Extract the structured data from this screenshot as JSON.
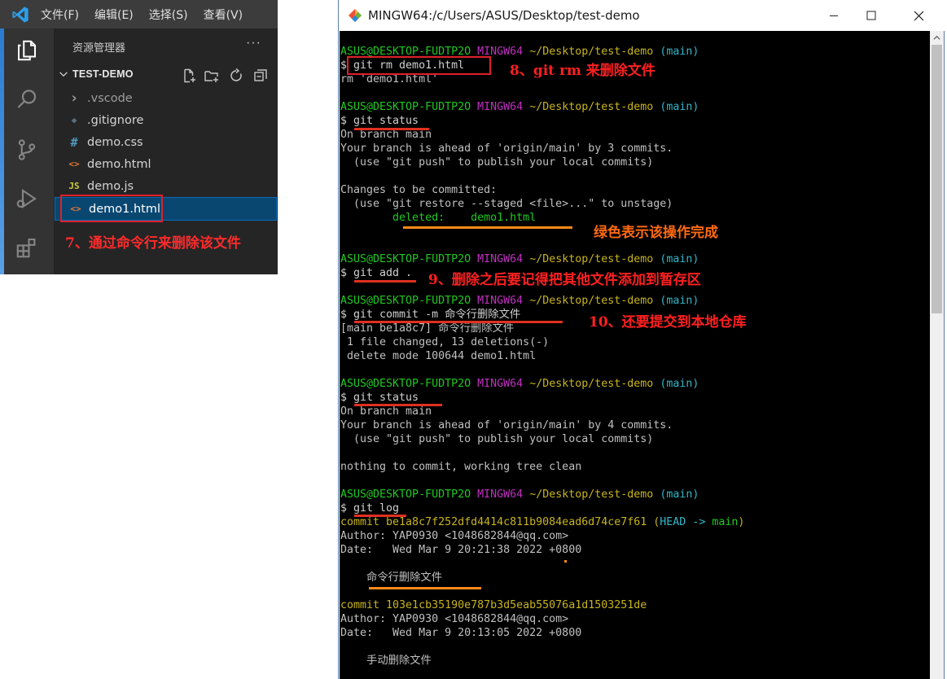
{
  "vscode": {
    "menu": [
      "文件(F)",
      "编辑(E)",
      "选择(S)",
      "查看(V)"
    ],
    "explorer_title": "资源管理器",
    "more": "···",
    "folder": "TEST-DEMO",
    "files": [
      {
        "name": ".vscode",
        "icon": "chevron-right-icon",
        "glyph": "›",
        "color": "#9d9d9d"
      },
      {
        "name": ".gitignore",
        "icon": "git-diamond-icon",
        "glyph": "◆",
        "color": "#5c6f7c"
      },
      {
        "name": "demo.css",
        "icon": "css-hash-icon",
        "glyph": "#",
        "color": "#519aba"
      },
      {
        "name": "demo.html",
        "icon": "html-brackets-icon",
        "glyph": "<>",
        "color": "#e37933"
      },
      {
        "name": "demo.js",
        "icon": "js-icon",
        "glyph": "JS",
        "color": "#cbcb41"
      },
      {
        "name": "demo1.html",
        "icon": "html-brackets-icon",
        "glyph": "<>",
        "color": "#e37933"
      }
    ],
    "annotation": "7、通过命令行来删除该文件"
  },
  "terminal": {
    "title": "MINGW64:/c/Users/ASUS/Desktop/test-demo",
    "prompt": {
      "user": "ASUS@DESKTOP-FUDTP2O",
      "env": "MINGW64",
      "path": "~/Desktop/test-demo",
      "branch": "(main)"
    },
    "cmd_rm": "$ git rm demo1.html",
    "out_rm": "rm 'demo1.html'",
    "cmd_status": "$ git status",
    "status1": [
      "On branch main",
      "Your branch is ahead of 'origin/main' by 3 commits.",
      "  (use \"git push\" to publish your local commits)",
      "",
      "Changes to be committed:",
      "  (use \"git restore --staged <file>...\" to unstage)"
    ],
    "deleted_line": "        deleted:    demo1.html",
    "cmd_add": "$ git add .",
    "cmd_commit": "$ git commit -m 命令行删除文件",
    "commit_out": [
      "[main be1a8c7] 命令行删除文件",
      " 1 file changed, 13 deletions(-)",
      " delete mode 100644 demo1.html"
    ],
    "status2": [
      "On branch main",
      "Your branch is ahead of 'origin/main' by 4 commits.",
      "  (use \"git push\" to publish your local commits)",
      "",
      "nothing to commit, working tree clean"
    ],
    "cmd_log": "$ git log",
    "log1": {
      "commit": "commit be1a8c7f252dfd4414c811b9084ead6d74ce7f61",
      "head_open": " (",
      "head": "HEAD -> ",
      "branch": "main",
      "head_close": ")",
      "author": "Author: YAP0930 <1048682844@qq.com>",
      "date": "Date:   Wed Mar 9 20:21:38 2022 +0800",
      "msg": "    命令行删除文件"
    },
    "log2": {
      "commit": "commit 103e1cb35190e787b3d5eab55076a1d1503251de",
      "author": "Author: YAP0930 <1048682844@qq.com>",
      "date": "Date:   Wed Mar 9 20:13:05 2022 +0800",
      "msg": "    手动删除文件"
    }
  },
  "annotations": {
    "a8": "8、git rm 来删除文件",
    "a_green": "绿色表示该操作完成",
    "a9": "9、删除之后要记得把其他文件添加到暂存区",
    "a10": "10、还要提交到本地仓库"
  }
}
